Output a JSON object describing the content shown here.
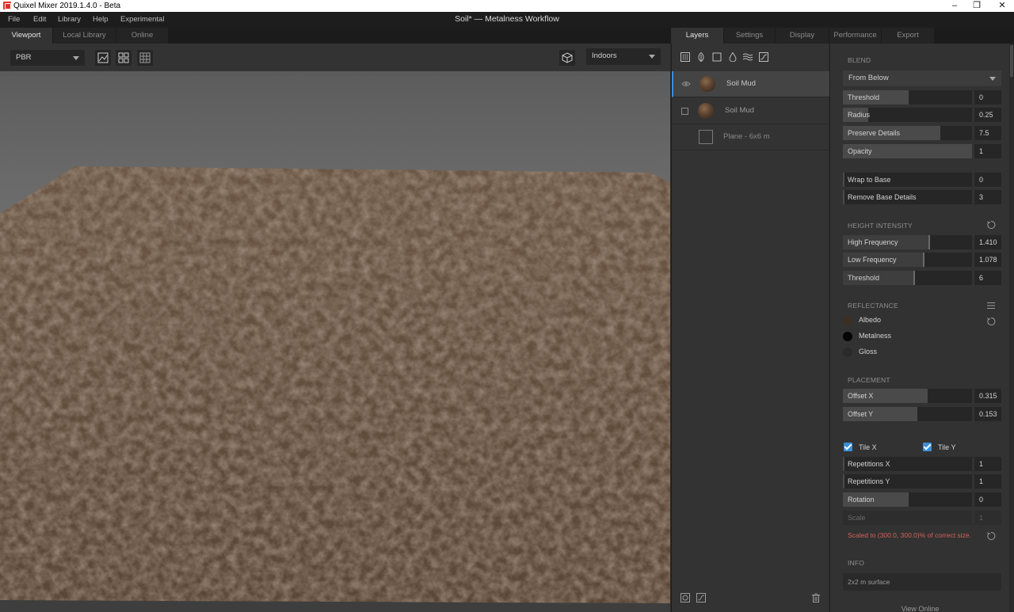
{
  "window": {
    "app_title": "Quixel Mixer 2019.1.4.0 - Beta",
    "document_title": "Soil* — Metalness Workflow",
    "minimize": "–",
    "maximize": "❐",
    "close": "✕"
  },
  "menu": [
    "File",
    "Edit",
    "Library",
    "Help",
    "Experimental"
  ],
  "left_tabs": [
    "Viewport",
    "Local Library",
    "Online"
  ],
  "right_tabs": [
    "Layers",
    "Settings",
    "Display",
    "Performance",
    "Export"
  ],
  "viewport": {
    "render_mode": "PBR",
    "environment": "Indoors",
    "toolbar_icons": [
      "image-icon",
      "quad-view-icon",
      "grid-icon"
    ],
    "env_icon": "cube-icon"
  },
  "layers": {
    "toolbar_icons": [
      "pattern-icon",
      "leaf-icon",
      "square-icon",
      "drop-icon",
      "waves-icon",
      "curve-icon"
    ],
    "items": [
      {
        "name": "Soil Mud",
        "selected": true,
        "visible": true
      },
      {
        "name": "Soil Mud",
        "selected": false,
        "visible": false
      },
      {
        "name": "Plane - 6x6 m",
        "selected": false
      }
    ]
  },
  "properties": {
    "blend": {
      "title": "BLEND",
      "mode": "From Below",
      "sliders": [
        {
          "label": "Threshold",
          "value": "0",
          "level": 0.5
        },
        {
          "label": "Radius",
          "value": "0.25",
          "level": 0.2
        },
        {
          "label": "Preserve Details",
          "value": "7.5",
          "level": 0.75
        },
        {
          "label": "Opacity",
          "value": "1",
          "level": 1.0
        }
      ],
      "sliders2": [
        {
          "label": "Wrap to Base",
          "value": "0",
          "level": 0.0
        },
        {
          "label": "Remove Base Details",
          "value": "3",
          "level": 0.0
        }
      ]
    },
    "height_intensity": {
      "title": "HEIGHT INTENSITY",
      "sliders": [
        {
          "label": "High Frequency",
          "value": "1.410",
          "level": 0.7
        },
        {
          "label": "Low Frequency",
          "value": "1.078",
          "level": 0.63
        },
        {
          "label": "Threshold",
          "value": "6",
          "level": 0.55
        }
      ]
    },
    "reflectance": {
      "title": "REFLECTANCE",
      "items": [
        {
          "label": "Albedo",
          "color": "#3b2f24"
        },
        {
          "label": "Metalness",
          "color": "#050505"
        },
        {
          "label": "Gloss",
          "color": "#2a2a2a"
        }
      ]
    },
    "placement": {
      "title": "PLACEMENT",
      "sliders": [
        {
          "label": "Offset X",
          "value": "0.315",
          "level": 0.66
        },
        {
          "label": "Offset Y",
          "value": "0.153",
          "level": 0.58
        }
      ],
      "tile_x": "Tile X",
      "tile_y": "Tile Y",
      "sliders2": [
        {
          "label": "Repetitions X",
          "value": "1",
          "level": 0.0
        },
        {
          "label": "Repetitions Y",
          "value": "1",
          "level": 0.0
        },
        {
          "label": "Rotation",
          "value": "0",
          "level": 0.5
        }
      ],
      "scale_label": "Scale",
      "scale_value": "1",
      "warning": "Scaled to (300.0, 300.0)% of correct size."
    },
    "info": {
      "title": "INFO",
      "text": "2x2 m surface",
      "link": "View Online"
    }
  },
  "colors": {
    "accent": "#3a8fd8",
    "warning": "#d2625c"
  }
}
